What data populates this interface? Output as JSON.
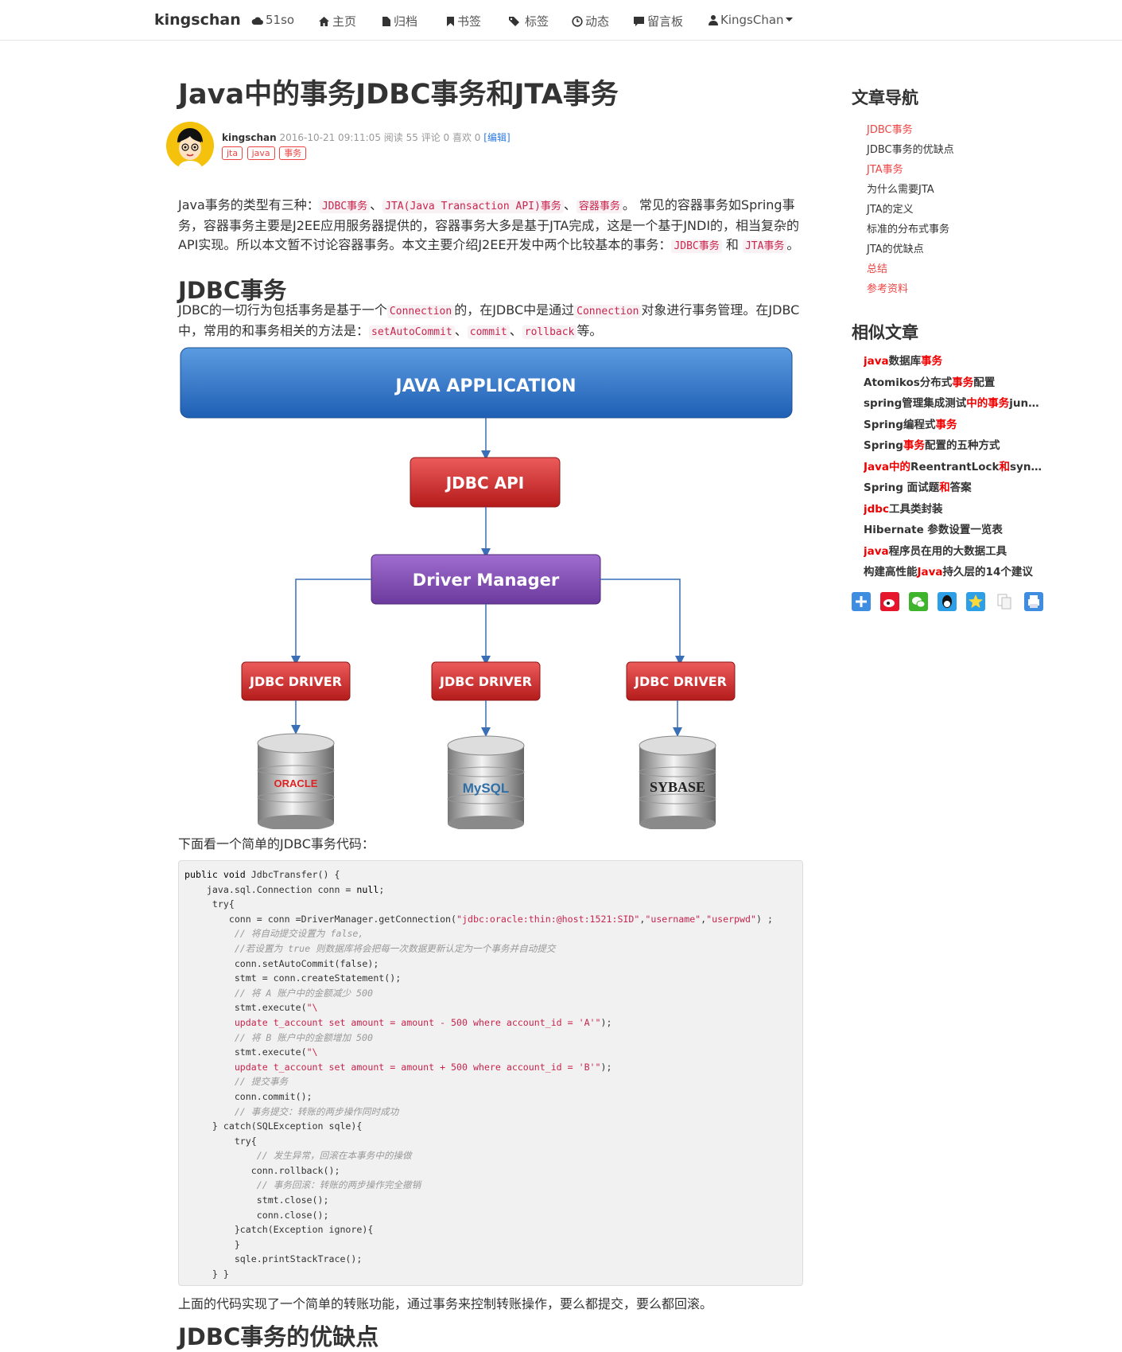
{
  "nav": {
    "brand": "kingschan",
    "items": [
      {
        "label": "51so",
        "icon": "cloud-icon"
      },
      {
        "label": "主页",
        "icon": "home-icon"
      },
      {
        "label": "归档",
        "icon": "file-icon"
      },
      {
        "label": "书签",
        "icon": "bookmark-icon"
      },
      {
        "label": "标签",
        "icon": "tags-icon"
      },
      {
        "label": "动态",
        "icon": "clock-icon"
      },
      {
        "label": "留言板",
        "icon": "comment-icon"
      },
      {
        "label": "KingsChan",
        "icon": "user-icon"
      }
    ]
  },
  "article": {
    "title": "Java中的事务JDBC事务和JTA事务",
    "author": "kingschan",
    "date": "2016-10-21 09:11:05",
    "read": "阅读 55",
    "comment": "评论 0",
    "like": "喜欢 0",
    "edit": "[编辑]",
    "tags": [
      "jta",
      "java",
      "事务"
    ],
    "intro": {
      "t1": "Java事务的类型有三种：",
      "c1": "JDBC事务",
      "t2": "、",
      "c2": "JTA(Java Transaction API)事务",
      "t3": "、",
      "c3": "容器事务",
      "t4": "。 常见的容器事务如Spring事务，容器事务主要是J2EE应用服务器提供的，容器事务大多是基于JTA完成，这是一个基于JNDI的，相当复杂的API实现。所以本文暂不讨论容器事务。本文主要介绍J2EE开发中两个比较基本的事务：",
      "c4": "JDBC事务",
      "t5": " 和 ",
      "c5": "JTA事务",
      "t6": "。"
    },
    "h2_jdbc": "JDBC事务",
    "jdbc_para": {
      "t1": "JDBC的一切行为包括事务是基于一个",
      "c1": "Connection",
      "t2": "的，在JDBC中是通过",
      "c2": "Connection",
      "t3": "对象进行事务管理。在JDBC中，常用的和事务相关的方法是：",
      "c3": "setAutoCommit",
      "t4": "、",
      "c4": "commit",
      "t5": "、",
      "c5": "rollback",
      "t6": "等。"
    },
    "diagram": {
      "app": "JAVA APPLICATION",
      "api": "JDBC API",
      "manager": "Driver Manager",
      "driver": "JDBC DRIVER",
      "db1": "ORACLE",
      "db2": "MySQL",
      "db3": "SYBASE"
    },
    "code_intro": "下面看一个简单的JDBC事务代码：",
    "code_after": "上面的代码实现了一个简单的转账功能，通过事务来控制转账操作，要么都提交，要么都回滚。",
    "h2_pros": "JDBC事务的优缺点"
  },
  "sidebar": {
    "toc_title": "文章导航",
    "toc": [
      {
        "label": "JDBC事务",
        "active": true
      },
      {
        "label": "JDBC事务的优缺点",
        "active": false
      },
      {
        "label": "JTA事务",
        "active": true
      },
      {
        "label": "为什么需要JTA",
        "active": false
      },
      {
        "label": "JTA的定义",
        "active": false
      },
      {
        "label": "标准的分布式事务",
        "active": false
      },
      {
        "label": "JTA的优缺点",
        "active": false
      },
      {
        "label": "总结",
        "active": true
      },
      {
        "label": "参考资料",
        "active": true
      }
    ],
    "related_title": "相似文章",
    "related": [
      "java数据库事务",
      "Atomikos分布式事务配置",
      "spring管理集成测试中的事务junit...",
      "Spring编程式事务",
      "Spring事务配置的五种方式",
      "Java中的ReentrantLock和synch...",
      "Spring 面试题和答案",
      "jdbc工具类封装",
      "Hibernate 参数设置一览表",
      "java程序员在用的大数据工具",
      "构建高性能Java持久层的14个建议"
    ],
    "share_icons": [
      "plus-share-icon",
      "weibo-icon",
      "wechat-icon",
      "qq-icon",
      "qzone-icon",
      "copy-icon",
      "print-icon"
    ]
  }
}
